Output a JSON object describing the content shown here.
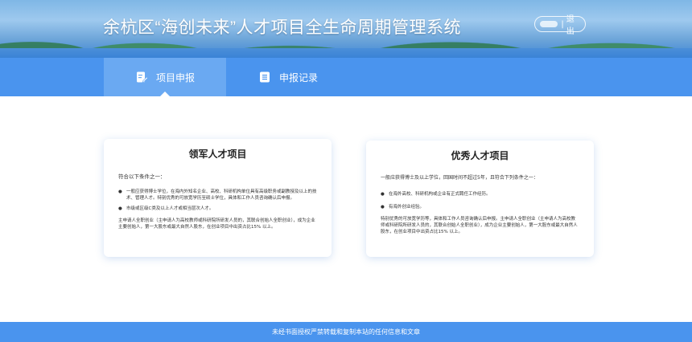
{
  "header": {
    "title": "余杭区“海创未来”人才项目全生命周期管理系统",
    "separator": "|",
    "logout_label": "退出"
  },
  "tabs": [
    {
      "label": "项目申报",
      "icon": "edit-document-icon",
      "active": true
    },
    {
      "label": "申报记录",
      "icon": "list-record-icon",
      "active": false
    }
  ],
  "cards": {
    "leading": {
      "title": "领军人才项目",
      "intro": "符合以下条件之一：",
      "items": [
        "一般应获得博士学位，在海内外知名企业、高校、科研机构单位具有高级职务或副教授及以上的技术、管理人才。特别优秀的可放宽学历至硕士学位，具体和工作人员咨询确认后申报。",
        "市级或区级C类及以上人才或相当层次人才。"
      ],
      "note": "主申请人全职创业（主申请人为高校教师或科研院所研发人员的，其联合创始人全职创业），成为企业主要创始人，第一大股东或最大自然人股东，在创业项目中出资占比15% 以上。"
    },
    "excellent": {
      "title": "优秀人才项目",
      "intro": "一般应获得博士及以上学位，回国时间不超过5年，且符合下列条件之一：",
      "items": [
        "在海外高校、科研机构或企业有正式聘任工作经历。",
        "有海外创业经验。"
      ],
      "note": "特别优秀的可放宽学历等，具体和工作人员咨询确认后申报。主申请人全职创业（主申请人为高校教师或科研院所研发人员的，其联合创始人全职创业），成为企业主要创始人，第一大股东或最大自然人股东，在创业项目中出资占比15% 以上。"
    }
  },
  "footer": {
    "text": "未经书面授权严禁转载和复制本站的任何信息和文章"
  },
  "colors": {
    "primary": "#4a94ee",
    "tab_active": "#6aa9f2"
  }
}
